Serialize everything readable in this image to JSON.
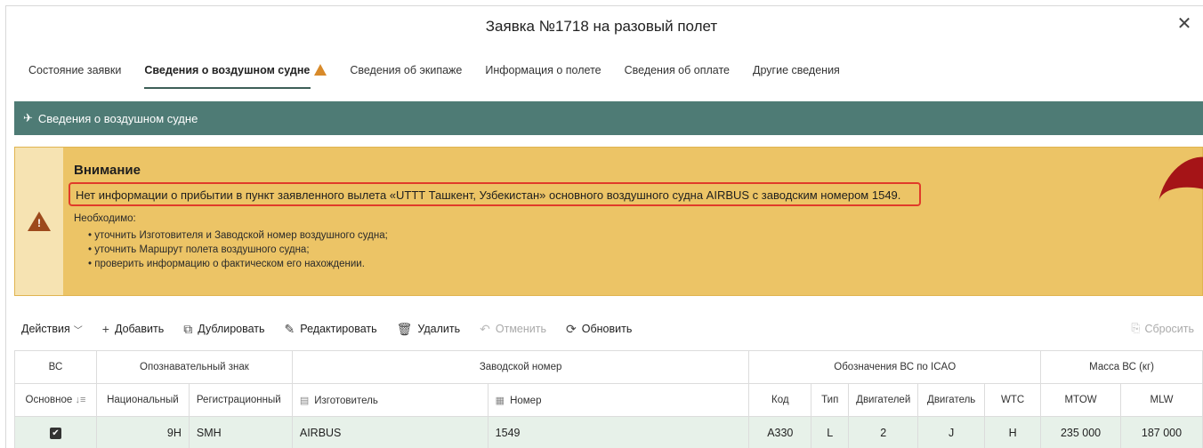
{
  "window": {
    "title": "Заявка №1718 на разовый полет",
    "close_symbol": "✕"
  },
  "tabs": [
    {
      "label": "Состояние заявки",
      "active": false
    },
    {
      "label": "Сведения о воздушном судне",
      "active": true,
      "warning": true
    },
    {
      "label": "Сведения об экипаже",
      "active": false
    },
    {
      "label": "Информация о полете",
      "active": false
    },
    {
      "label": "Сведения об оплате",
      "active": false
    },
    {
      "label": "Другие сведения",
      "active": false
    }
  ],
  "section": {
    "title": "Сведения о воздушном судне",
    "icon": "airplane-icon"
  },
  "alert": {
    "title": "Внимание",
    "message": "Нет информации о прибытии в пункт заявленного вылета «UTTT Ташкент, Узбекистан» основного воздушного судна AIRBUS с заводским номером 1549.",
    "need_label": "Необходимо:",
    "items": [
      "уточнить Изготовителя и Заводской номер воздушного судна;",
      "уточнить Маршрут полета воздушного судна;",
      "проверить информацию о фактическом его нахождении."
    ]
  },
  "toolbar": {
    "actions": "Действия",
    "add": "Добавить",
    "duplicate": "Дублировать",
    "edit": "Редактировать",
    "delete": "Удалить",
    "cancel": "Отменить",
    "refresh": "Обновить",
    "reset": "Сбросить"
  },
  "table": {
    "groups": {
      "vs": "ВС",
      "callsign": "Опознавательный знак",
      "serial": "Заводской номер",
      "icao": "Обозначения ВС по ICAO",
      "mass": "Масса ВС (кг)"
    },
    "columns": {
      "main": "Основное",
      "national": "Национальный",
      "registration": "Регистрационный",
      "manufacturer": "Изготовитель",
      "number": "Номер",
      "code": "Код",
      "type": "Тип",
      "engines": "Двигателей",
      "engine": "Двигатель",
      "wtc": "WTC",
      "mtow": "MTOW",
      "mlw": "MLW"
    },
    "row": {
      "checked": "✔",
      "national": "9H",
      "registration": "SMH",
      "manufacturer": "AIRBUS",
      "number": "1549",
      "code": "A330",
      "type": "L",
      "engines": "2",
      "engine": "J",
      "wtc": "H",
      "mtow": "235 000",
      "mlw": "187 000"
    }
  },
  "colors": {
    "header_bg": "#4e7b75",
    "alert_bg": "#ecc466",
    "alert_highlight": "#e03b2a",
    "row_bg": "#e7f1e9"
  }
}
